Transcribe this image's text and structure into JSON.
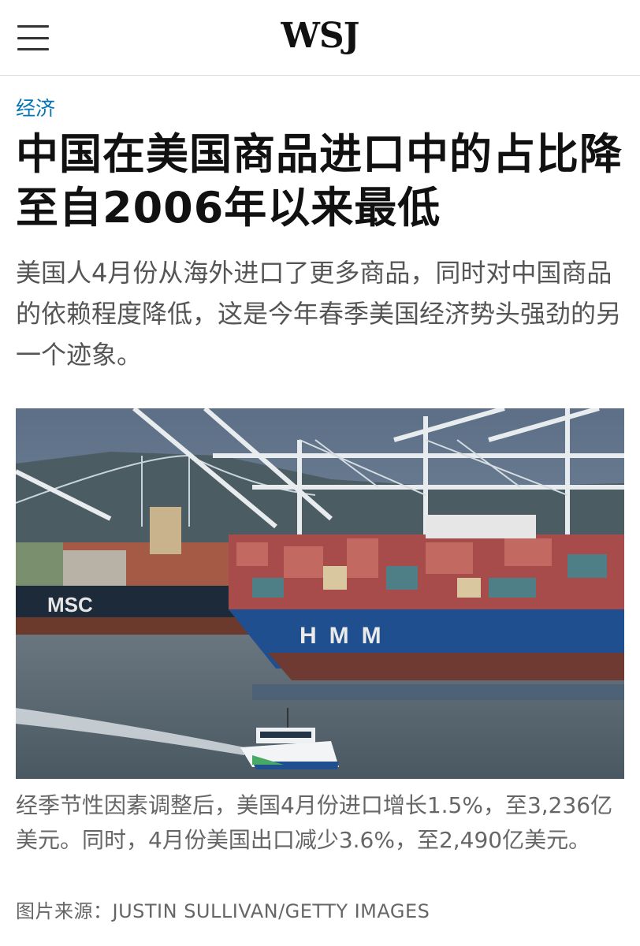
{
  "header": {
    "logo": "WSJ",
    "menu_icon": "hamburger-menu-icon"
  },
  "article": {
    "section": "经济",
    "headline": "中国在美国商品进口中的占比降至自2006年以来最低",
    "dek": "美国人4月份从海外进口了更多商品，同时对中国商品的依赖程度降低，这是今年春季美国经济势头强劲的另一个迹象。",
    "photo": {
      "ship_left_name": "MSC",
      "ship_right_name": "HMM"
    },
    "caption": "经季节性因素调整后，美国4月份进口增长1.5%，至3,236亿美元。同时，4月份美国出口减少3.6%，至2,490亿美元。",
    "credit": "图片来源：JUSTIN SULLIVAN/GETTY IMAGES"
  },
  "colors": {
    "section_link": "#0274b6",
    "headline": "#111111",
    "body_gray": "#555555"
  }
}
